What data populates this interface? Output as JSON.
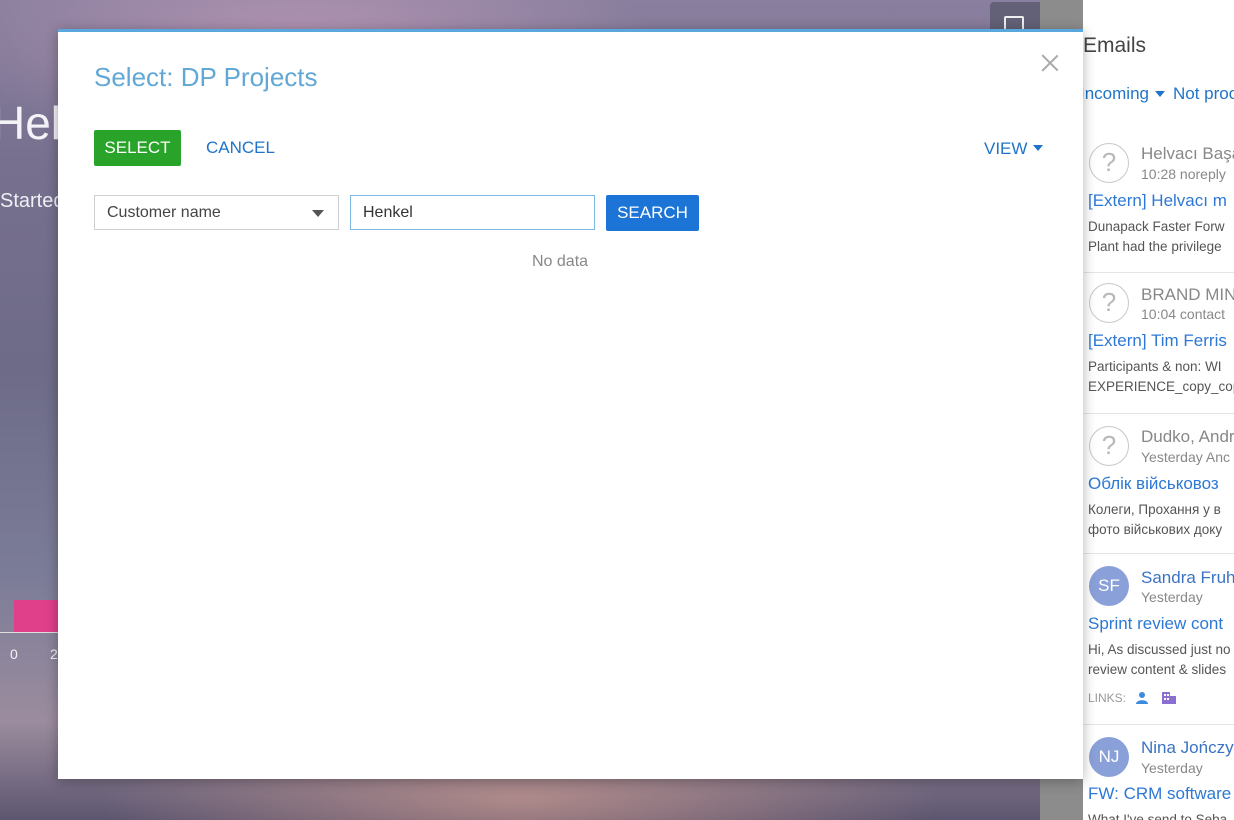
{
  "background": {
    "greeting": "Hello",
    "subtitle": "Started p",
    "chart_ticks": [
      "0",
      "2"
    ]
  },
  "emails_panel": {
    "title": "Emails",
    "filters": [
      "Incoming",
      "Not proc"
    ],
    "items": [
      {
        "avatar": "?",
        "sender": "Helvacı Başa",
        "time": "10:28  noreply",
        "subject": "[Extern] Helvacı m",
        "preview": [
          "Dunapack Faster Forw",
          "Plant had the privilege"
        ]
      },
      {
        "avatar": "?",
        "sender": "BRAND MIND",
        "time": "10:04  contact",
        "subject": "[Extern] Tim Ferris",
        "preview": [
          "Participants & non: WI",
          "EXPERIENCE_copy_cop"
        ]
      },
      {
        "avatar": "?",
        "sender": "Dudko, Andr",
        "time": "Yesterday  Anc",
        "subject": "Облік військовоз",
        "preview": [
          "Колеги, Прохання у в",
          "фото військових доку"
        ]
      },
      {
        "avatar": "SF",
        "sender": "Sandra Fruh",
        "time": "Yesterday",
        "subject": "Sprint review cont",
        "preview": [
          "Hi, As discussed just no",
          "review content & slides"
        ],
        "links_label": "LINKS:"
      },
      {
        "avatar": "NJ",
        "sender": "Nina Jończyk",
        "time": "Yesterday",
        "subject": "FW: CRM software",
        "preview": [
          "What I've send to Seba"
        ]
      }
    ]
  },
  "dialog": {
    "title": "Select: DP Projects",
    "select_label": "SELECT",
    "cancel_label": "CANCEL",
    "view_label": "VIEW",
    "filter_column": "Customer name",
    "search_value": "Henkel",
    "search_label": "SEARCH",
    "empty_text": "No data"
  }
}
